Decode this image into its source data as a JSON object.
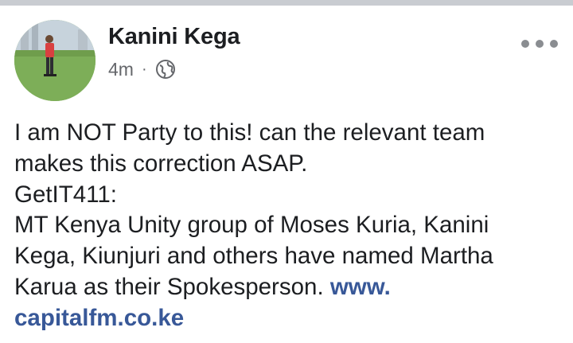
{
  "post": {
    "author": "Kanini Kega",
    "timestamp": "4m",
    "separator": "·",
    "privacy_icon": "globe-icon",
    "more_icon": "more-options-icon",
    "lines": [
      "I am NOT Party to this! can the relevant team",
      "makes this correction ASAP.",
      "GetIT411:",
      "MT Kenya Unity group of Moses Kuria, Kanini",
      "Kega, Kiunjuri and others have named Martha",
      "Karua as their Spokesperson. "
    ],
    "link_part1": "www.",
    "link_part2": "capitalfm.co.ke",
    "colors": {
      "text": "#1c1e21",
      "meta": "#65676b",
      "link": "#385898"
    }
  }
}
